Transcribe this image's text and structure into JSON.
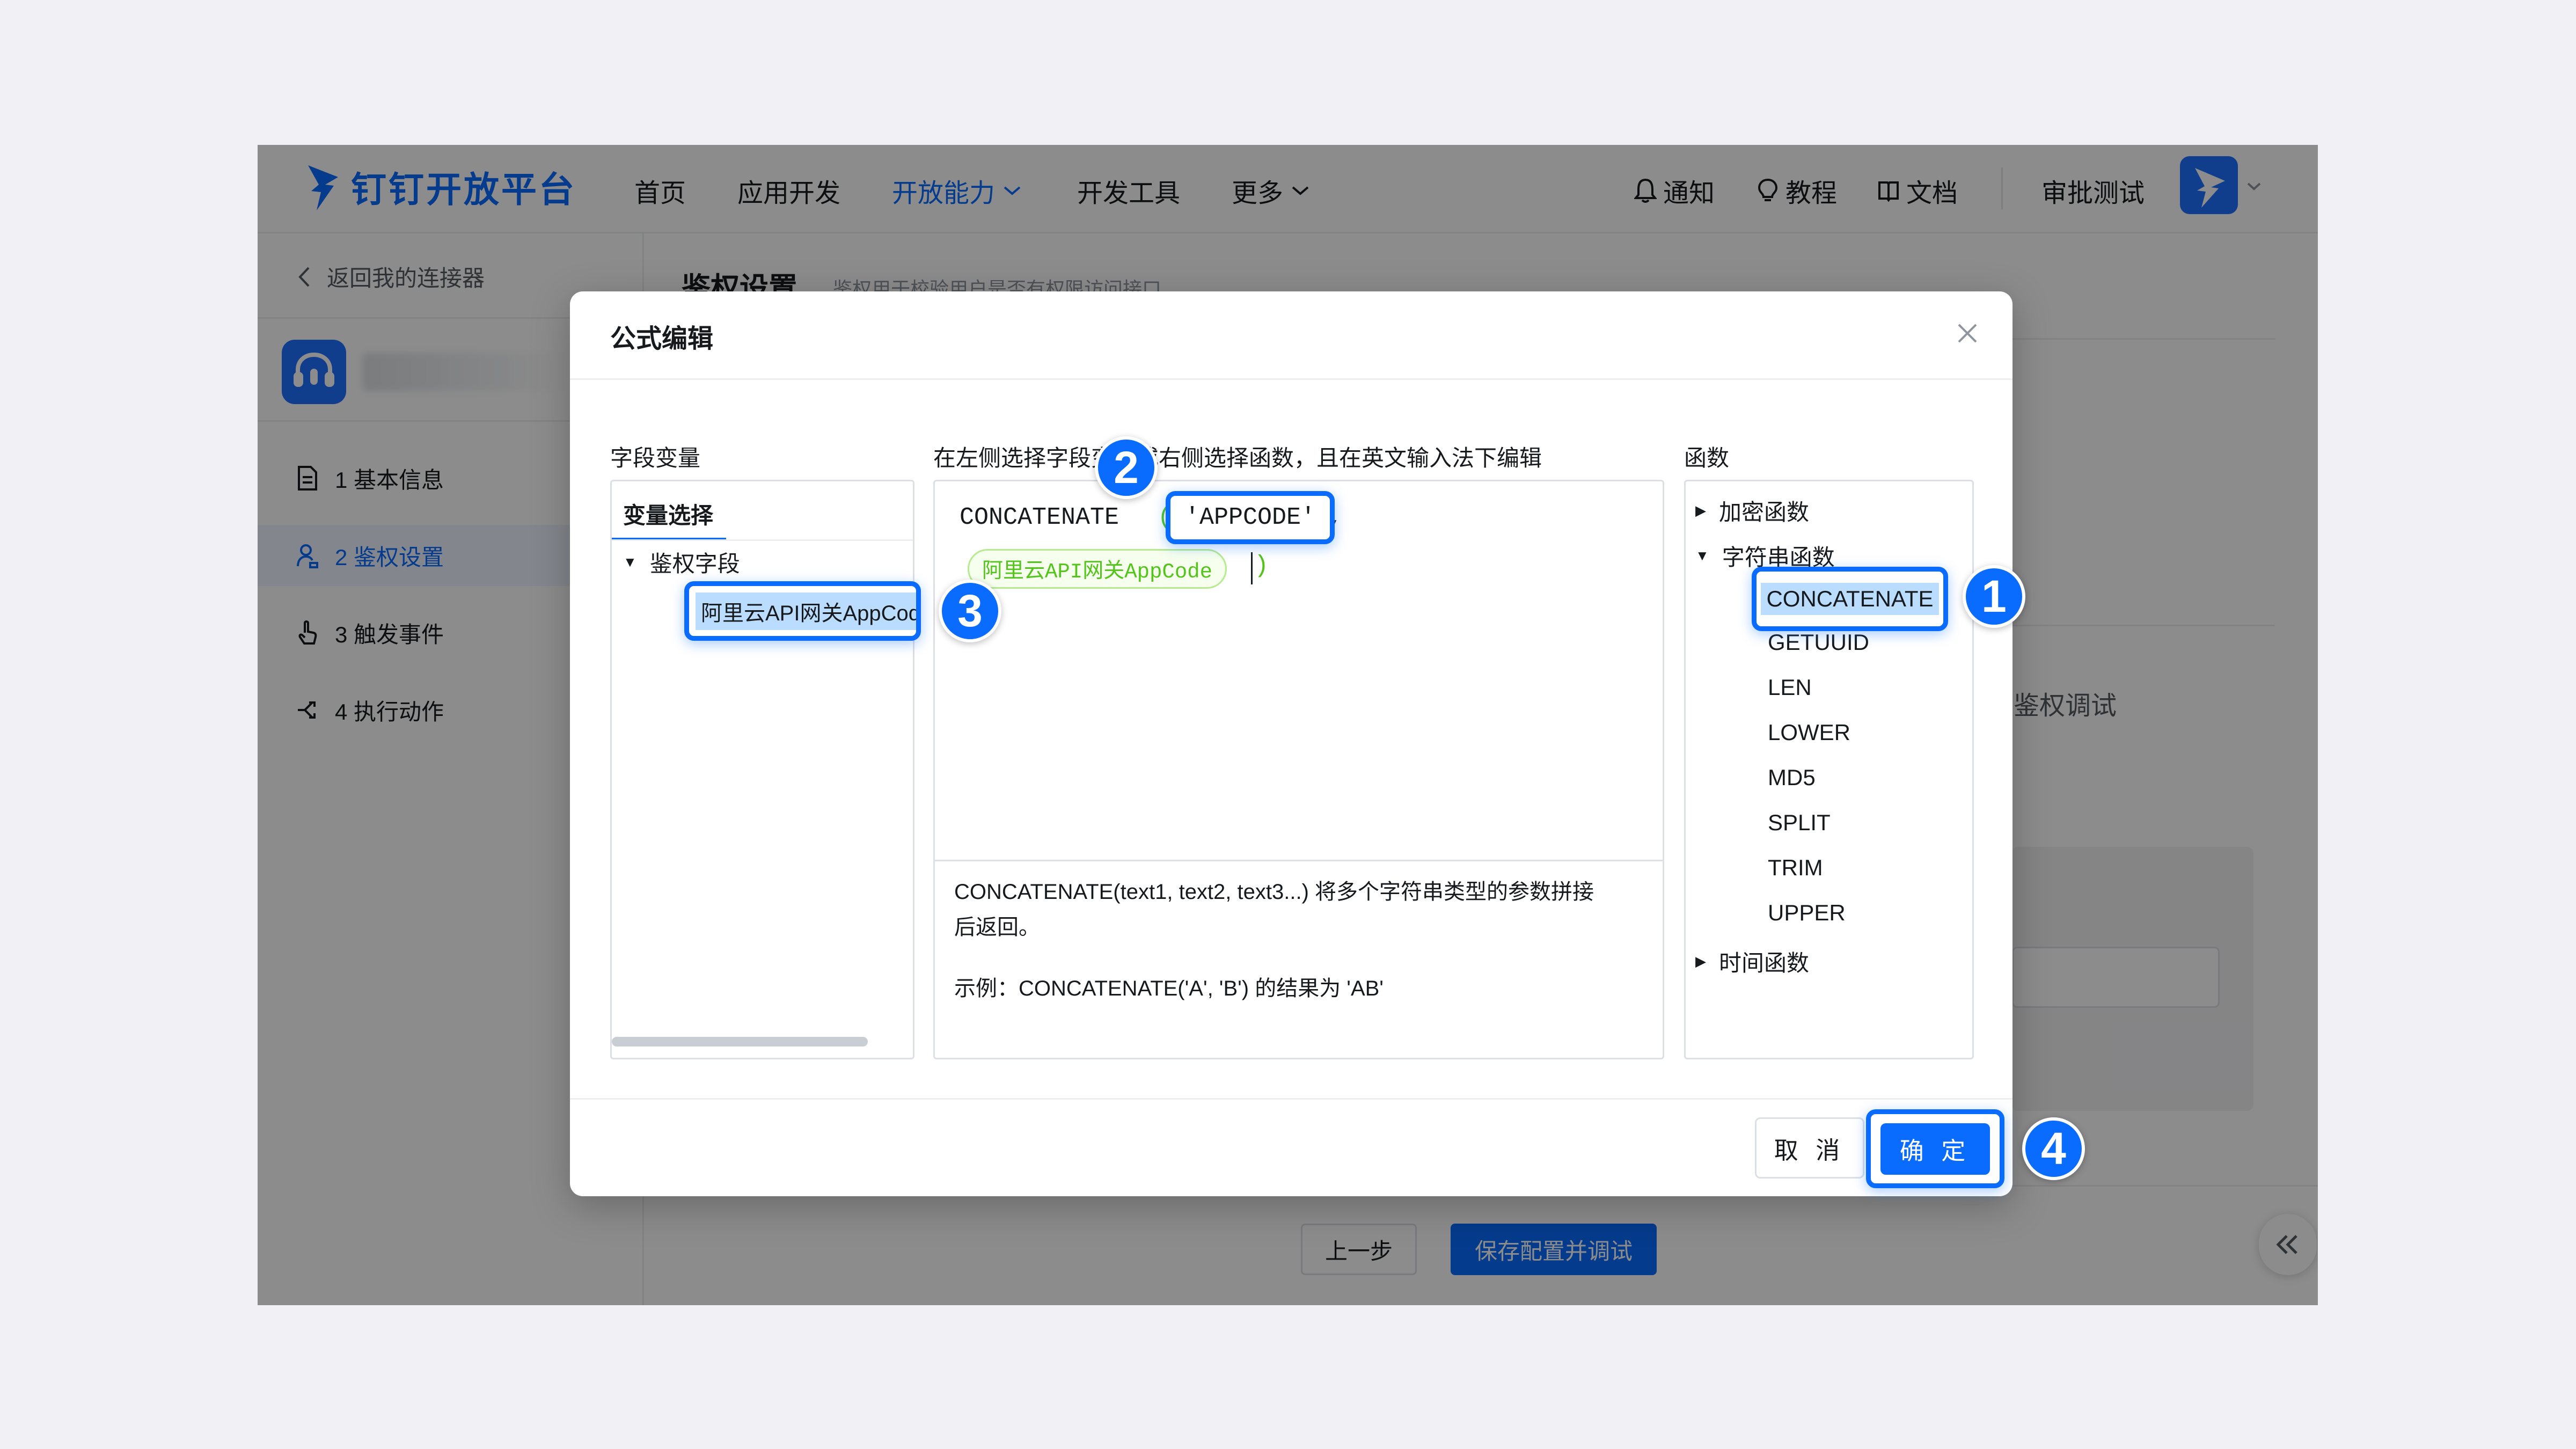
{
  "brand": {
    "name": "钉钉开放平台"
  },
  "nav": {
    "items": [
      {
        "label": "首页"
      },
      {
        "label": "应用开发"
      },
      {
        "label": "开放能力"
      },
      {
        "label": "开发工具"
      },
      {
        "label": "更多"
      }
    ],
    "notify_label": "通知",
    "tutorial_label": "教程",
    "docs_label": "文档",
    "user_label": "审批测试"
  },
  "sidebar": {
    "back_label": "返回我的连接器",
    "steps": [
      {
        "label": "1 基本信息"
      },
      {
        "label": "2 鉴权设置"
      },
      {
        "label": "3 触发事件"
      },
      {
        "label": "4 执行动作"
      }
    ]
  },
  "main": {
    "title": "鉴权设置",
    "subtitle": "鉴权用于校验用户是否有权限访问接口",
    "debug_label": "鉴权调试",
    "prev_label": "上一步",
    "save_label": "保存配置并调试"
  },
  "modal": {
    "title": "公式编辑",
    "variables": {
      "header": "字段变量",
      "tab_label": "变量选择",
      "group_label": "鉴权字段",
      "item_label": "阿里云API网关AppCode"
    },
    "editor": {
      "hint": "在左侧选择字段变量或右侧选择函数，且在英文输入法下编辑",
      "function_text": "CONCATENATE",
      "open_paren": "(",
      "string_arg": "'APPCODE'",
      "comma": ",",
      "variable_chip": "阿里云API网关AppCode",
      "close_paren": ")",
      "description_line1": "CONCATENATE(text1, text2, text3...) 将多个字符串类型的参数拼接",
      "description_line2": "后返回。",
      "example": "示例：CONCATENATE('A', 'B') 的结果为 'AB'"
    },
    "functions": {
      "header": "函数",
      "groups": [
        {
          "label": "加密函数"
        },
        {
          "label": "字符串函数"
        },
        {
          "label": "时间函数"
        }
      ],
      "string_functions": [
        "CONCATENATE",
        "GETUUID",
        "LEN",
        "LOWER",
        "MD5",
        "SPLIT",
        "TRIM",
        "UPPER"
      ]
    },
    "cancel_label": "取 消",
    "confirm_label": "确 定"
  },
  "callouts": [
    "1",
    "2",
    "3",
    "4"
  ],
  "colors": {
    "accent": "#0a6cff",
    "chip_text": "#52c41a",
    "overlay": "rgba(0,0,0,0.45)"
  }
}
